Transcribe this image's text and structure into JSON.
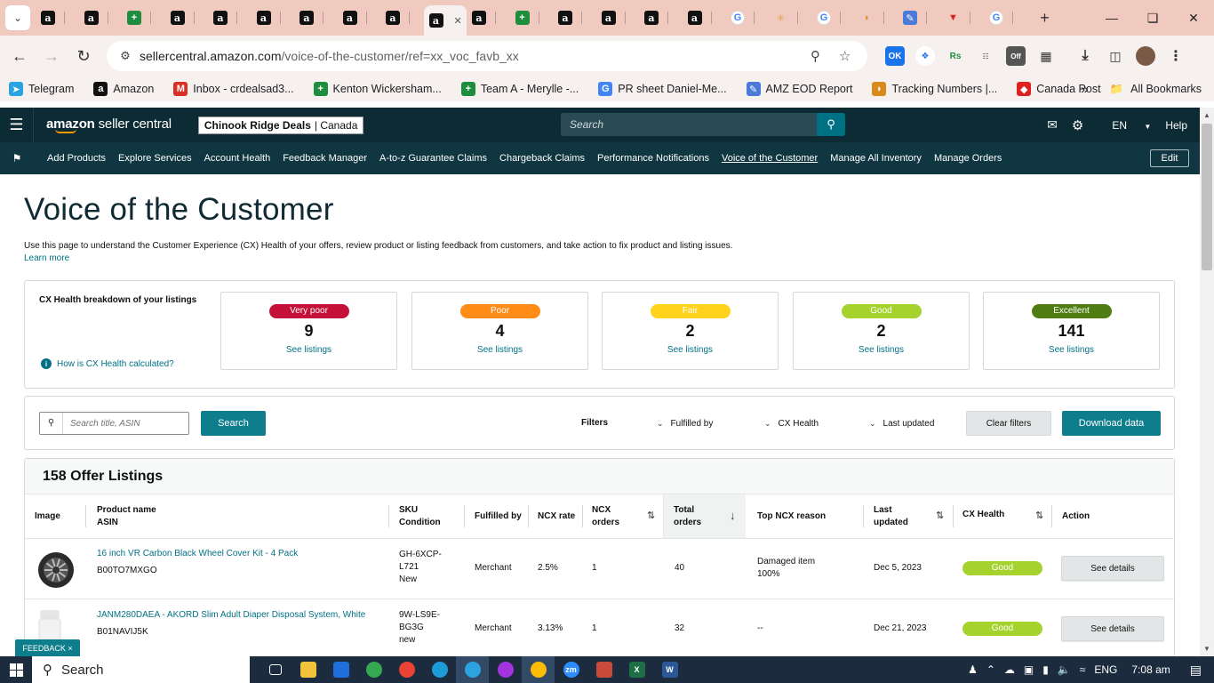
{
  "browser": {
    "tabs": [
      {
        "icon": "amazon-icon"
      },
      {
        "icon": "amazon-icon"
      },
      {
        "icon": "sheets-icon"
      },
      {
        "icon": "amazon-icon"
      },
      {
        "icon": "amazon-icon"
      },
      {
        "icon": "amazon-icon"
      },
      {
        "icon": "amazon-icon"
      },
      {
        "icon": "amazon-icon"
      },
      {
        "icon": "amazon-icon"
      },
      {
        "icon": "amazon-icon",
        "active": true
      },
      {
        "icon": "amazon-icon"
      },
      {
        "icon": "sheets-icon"
      },
      {
        "icon": "amazon-icon"
      },
      {
        "icon": "amazon-icon"
      },
      {
        "icon": "amazon-icon"
      },
      {
        "icon": "amazon-icon"
      },
      {
        "icon": "google-icon"
      },
      {
        "icon": "star-icon"
      },
      {
        "icon": "google-icon"
      },
      {
        "icon": "taco-icon"
      },
      {
        "icon": "clip-icon"
      },
      {
        "icon": "triangle-icon"
      },
      {
        "icon": "google-icon"
      }
    ],
    "url_host": "sellercentral.amazon.com",
    "url_path": "/voice-of-the-customer/ref=xx_voc_favb_xx",
    "bookmarks": [
      {
        "label": "Telegram",
        "icon": "telegram-icon",
        "color": "#2aa3df"
      },
      {
        "label": "Amazon",
        "icon": "amazon-icon",
        "color": "#111111"
      },
      {
        "label": "Inbox - crdealsad3...",
        "icon": "gmail-icon",
        "color": "#d93025"
      },
      {
        "label": "Kenton Wickersham...",
        "icon": "sheets-icon",
        "color": "#1e8e3e"
      },
      {
        "label": "Team A - Merylle -...",
        "icon": "sheets-icon",
        "color": "#1e8e3e"
      },
      {
        "label": "PR sheet Daniel-Me...",
        "icon": "google-icon",
        "color": "#4285f4"
      },
      {
        "label": "AMZ EOD Report",
        "icon": "clip-icon",
        "color": "#4b7bd8"
      },
      {
        "label": "Tracking Numbers |...",
        "icon": "taco-icon",
        "color": "#d88b1b"
      },
      {
        "label": "Canada Post",
        "icon": "canada-post-icon",
        "color": "#d22"
      }
    ],
    "all_bookmarks": "All Bookmarks",
    "more": "»"
  },
  "header": {
    "logo_bold": "amazon",
    "logo_rest": "seller central",
    "store_name": "Chinook Ridge Deals",
    "store_country": "| Canada",
    "search_placeholder": "Search",
    "language": "EN",
    "help": "Help"
  },
  "nav": {
    "items": [
      "Add Products",
      "Explore Services",
      "Account Health",
      "Feedback Manager",
      "A-to-z Guarantee Claims",
      "Chargeback Claims",
      "Performance Notifications",
      "Voice of the Customer",
      "Manage All Inventory",
      "Manage Orders"
    ],
    "current": "Voice of the Customer",
    "edit": "Edit"
  },
  "page": {
    "title": "Voice of the Customer",
    "description": "Use this page to understand the Customer Experience (CX) Health of your offers, review product or listing feedback from customers, and take action to fix product and listing issues.",
    "learn_more": "Learn more"
  },
  "cx_health": {
    "label": "CX Health breakdown of your listings",
    "how_link": "How is CX Health calculated?",
    "cards": [
      {
        "rating": "Very poor",
        "count": "9",
        "link": "See listings",
        "color": "#c40f39",
        "text_color": "#ffffff"
      },
      {
        "rating": "Poor",
        "count": "4",
        "link": "See listings",
        "color": "#ff8c17",
        "text_color": "#ffffff"
      },
      {
        "rating": "Fair",
        "count": "2",
        "link": "See listings",
        "color": "#ffd21c",
        "text_color": "#ffffff"
      },
      {
        "rating": "Good",
        "count": "2",
        "link": "See listings",
        "color": "#a6d22e",
        "text_color": "#ffffff"
      },
      {
        "rating": "Excellent",
        "count": "141",
        "link": "See listings",
        "color": "#4f7d12",
        "text_color": "#ffffff"
      }
    ]
  },
  "filters": {
    "search_placeholder": "Search title, ASIN",
    "search_button": "Search",
    "label": "Filters",
    "fulfilled_by": "Fulfilled by",
    "cx_health": "CX Health",
    "last_updated": "Last updated",
    "clear": "Clear filters",
    "download": "Download data"
  },
  "table": {
    "title": "158 Offer Listings",
    "columns": {
      "image": "Image",
      "product_name": "Product name",
      "asin": "ASIN",
      "sku": "SKU",
      "condition": "Condition",
      "fulfilled_by": "Fulfilled by",
      "ncx_rate": "NCX rate",
      "ncx_orders_1": "NCX",
      "ncx_orders_2": "orders",
      "total_orders_1": "Total",
      "total_orders_2": "orders",
      "top_reason": "Top NCX reason",
      "last_updated_1": "Last",
      "last_updated_2": "updated",
      "cx_health": "CX Health",
      "action": "Action"
    },
    "rows": [
      {
        "product": "16 inch VR Carbon Black Wheel Cover Kit - 4 Pack",
        "asin": "B00TO7MXGO",
        "sku_1": "GH-6XCP-",
        "sku_2": "L721",
        "condition": "New",
        "fulfilled": "Merchant",
        "ncx_rate": "2.5%",
        "ncx_orders": "1",
        "total_orders": "40",
        "reason_1": "Damaged item",
        "reason_2": "100%",
        "updated": "Dec 5, 2023",
        "health": "Good",
        "action": "See details"
      },
      {
        "product": "JANM280DAEA - AKORD Slim Adult Diaper Disposal System, White",
        "asin": "B01NAVIJ5K",
        "sku_1": "9W-LS9E-",
        "sku_2": "BG3G",
        "condition": "new",
        "fulfilled": "Merchant",
        "ncx_rate": "3.13%",
        "ncx_orders": "1",
        "total_orders": "32",
        "reason_1": "--",
        "reason_2": "",
        "updated": "Dec 21, 2023",
        "health": "Good",
        "action": "See details"
      }
    ]
  },
  "feedback": "FEEDBACK ×",
  "taskbar": {
    "search": "Search",
    "language": "ENG",
    "time": "7:08 am"
  }
}
